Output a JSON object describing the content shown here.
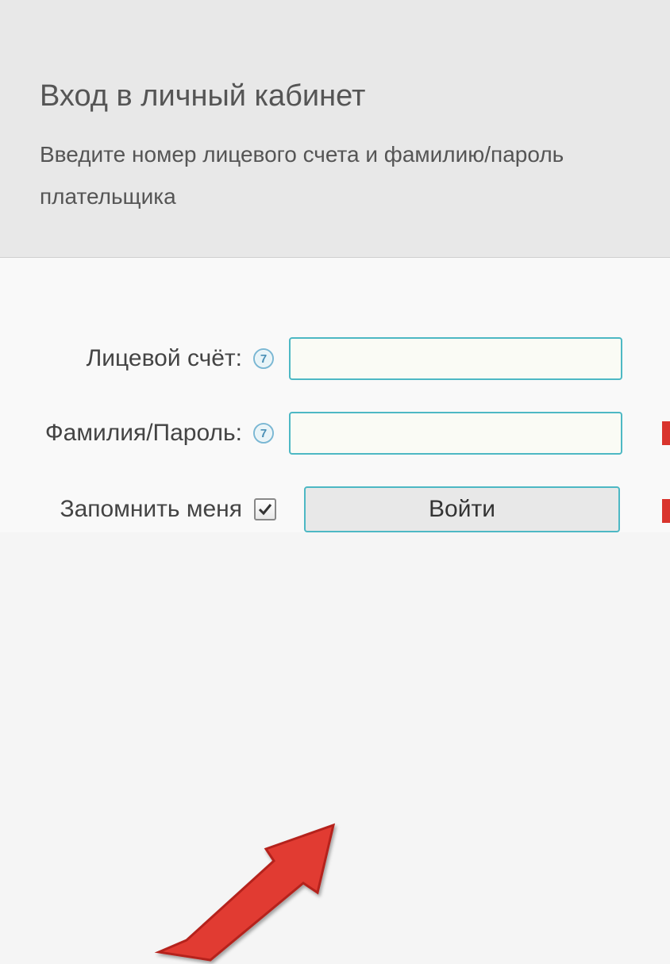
{
  "header": {
    "title": "Вход в личный кабинет",
    "subtitle": "Введите номер лицевого счета и фамилию/пароль плательщика"
  },
  "form": {
    "account_label": "Лицевой счёт:",
    "account_value": "",
    "password_label": "Фамилия/Пароль:",
    "password_value": "",
    "remember_label": "Запомнить меня",
    "login_button_label": "Войти",
    "help_icon_char": "7"
  },
  "colors": {
    "input_border": "#4db8c4",
    "arrow_fill": "#e13b33",
    "arrow_stroke": "#b5241d"
  }
}
